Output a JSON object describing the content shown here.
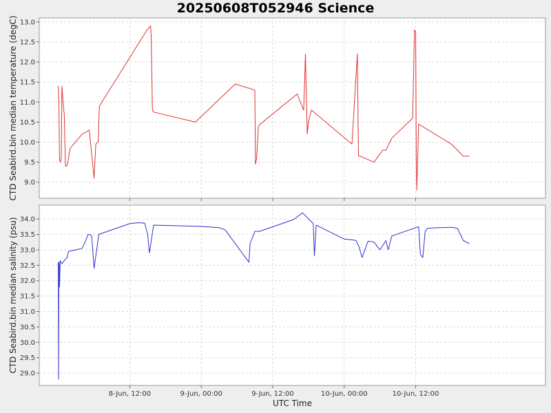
{
  "chart_data": {
    "title": "20250608T052946 Science",
    "xlabel": "UTC Time",
    "x_ticks": [
      "8-Jun, 12:00",
      "9-Jun, 00:00",
      "9-Jun, 12:00",
      "10-Jun, 00:00",
      "10-Jun, 12:00"
    ],
    "x_tick_hours": [
      12,
      24,
      36,
      48,
      60
    ],
    "xlim_hours": [
      -3.2,
      81.8
    ],
    "x_unit_note": "hours after 8-Jun 00:00 UTC",
    "grid": true,
    "panels": [
      {
        "type": "line",
        "ylabel": "CTD Seabird.bin median temperature (degC)",
        "ylim": [
          8.6,
          13.1
        ],
        "y_ticks": [
          9.0,
          9.5,
          10.0,
          10.5,
          11.0,
          11.5,
          12.0,
          12.5,
          13.0
        ],
        "color": "#e03030",
        "series": {
          "x": [
            0.0,
            0.1,
            0.2,
            0.3,
            0.5,
            0.6,
            0.7,
            0.8,
            0.9,
            1.0,
            1.2,
            1.4,
            1.6,
            2.0,
            4.0,
            5.2,
            6.0,
            6.3,
            6.6,
            6.7,
            6.9,
            14.9,
            15.5,
            15.6,
            15.8,
            16.0,
            23.0,
            29.7,
            33.0,
            33.1,
            33.3,
            33.6,
            33.9,
            40.1,
            41.2,
            41.5,
            41.8,
            42.0,
            42.5,
            49.3,
            50.2,
            50.4,
            50.7,
            53.0,
            54.5,
            55.0,
            56.0,
            59.5,
            59.8,
            60.0,
            60.1,
            60.2,
            60.5,
            66.0,
            68.0,
            68.3,
            69.0
          ],
          "y": [
            11.4,
            11.0,
            9.6,
            9.5,
            9.6,
            11.4,
            11.2,
            11.0,
            10.8,
            10.7,
            9.4,
            9.4,
            9.5,
            9.85,
            10.2,
            10.3,
            9.1,
            9.95,
            10.0,
            10.0,
            10.9,
            12.8,
            12.9,
            12.6,
            10.8,
            10.75,
            10.5,
            11.45,
            11.3,
            9.45,
            9.6,
            10.4,
            10.45,
            11.2,
            10.8,
            12.2,
            10.2,
            10.5,
            10.8,
            9.95,
            12.2,
            9.65,
            9.65,
            9.5,
            9.8,
            9.8,
            10.1,
            10.6,
            12.8,
            12.75,
            9.6,
            8.8,
            10.45,
            9.95,
            9.65,
            9.65,
            9.65
          ]
        }
      },
      {
        "type": "line",
        "ylabel": "CTD Seabird.bin median salinity (psu)",
        "ylim": [
          28.6,
          34.45
        ],
        "y_ticks": [
          29.0,
          29.5,
          30.0,
          30.5,
          31.0,
          31.5,
          32.0,
          32.5,
          33.0,
          33.5,
          34.0
        ],
        "color": "#3030d0",
        "series": {
          "x": [
            0.0,
            0.05,
            0.1,
            0.15,
            0.2,
            0.3,
            0.45,
            0.6,
            1.2,
            1.5,
            1.7,
            3.0,
            4.0,
            4.5,
            5.0,
            5.3,
            5.6,
            6.0,
            6.8,
            12.0,
            13.5,
            14.5,
            15.0,
            15.3,
            16.0,
            20.0,
            24.0,
            27.0,
            28.0,
            32.0,
            32.2,
            33.0,
            33.8,
            39.5,
            41.0,
            42.3,
            42.8,
            43.0,
            43.3,
            48.0,
            49.5,
            50.0,
            50.5,
            51.0,
            52.0,
            53.0,
            54.0,
            55.0,
            55.4,
            56.0,
            60.5,
            60.8,
            61.2,
            61.6,
            62.0,
            64.0,
            66.0,
            67.0,
            67.5,
            68.0,
            69.0
          ],
          "y": [
            32.6,
            28.8,
            32.6,
            32.5,
            31.8,
            32.65,
            32.6,
            32.55,
            32.7,
            32.75,
            32.95,
            33.0,
            33.05,
            33.25,
            33.5,
            33.5,
            33.45,
            32.4,
            33.5,
            33.85,
            33.88,
            33.86,
            33.5,
            32.9,
            33.8,
            33.78,
            33.76,
            33.72,
            33.65,
            32.6,
            33.2,
            33.6,
            33.6,
            33.98,
            34.2,
            33.95,
            33.85,
            32.8,
            33.8,
            33.35,
            33.32,
            33.3,
            33.1,
            32.75,
            33.28,
            33.25,
            33.0,
            33.3,
            33.0,
            33.45,
            33.75,
            32.85,
            32.75,
            33.6,
            33.7,
            33.72,
            33.73,
            33.7,
            33.5,
            33.3,
            33.2
          ]
        }
      }
    ]
  }
}
